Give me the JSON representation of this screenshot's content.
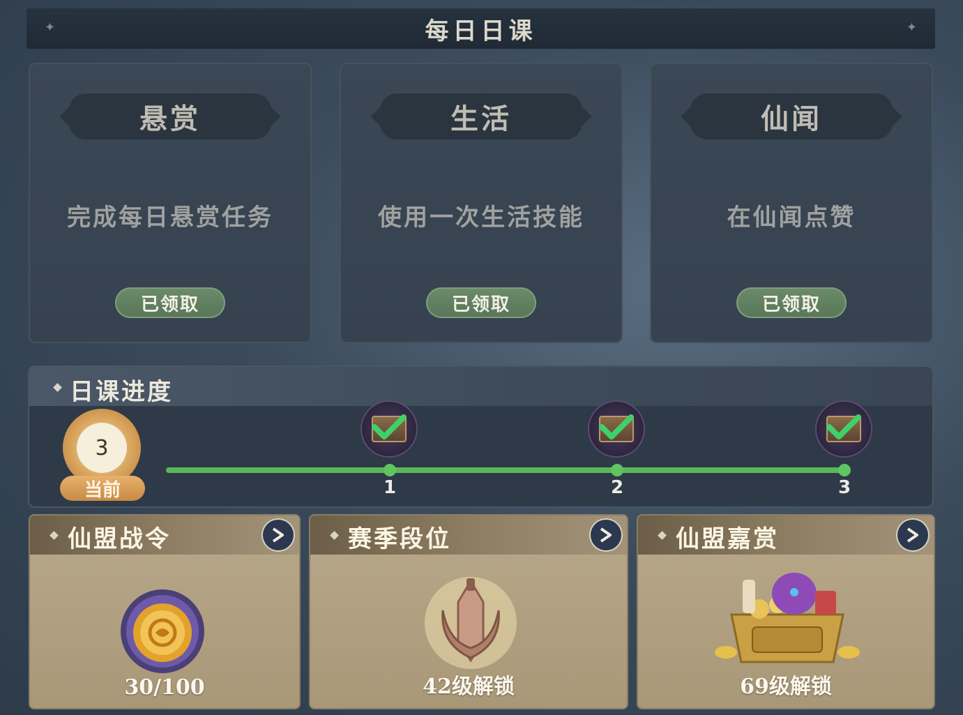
{
  "header": {
    "title": "每日日课"
  },
  "tasks": [
    {
      "category": "悬赏",
      "description": "完成每日悬赏任务",
      "status": "已领取"
    },
    {
      "category": "生活",
      "description": "使用一次生活技能",
      "status": "已领取"
    },
    {
      "category": "仙闻",
      "description": "在仙闻点赞",
      "status": "已领取"
    }
  ],
  "progress": {
    "title": "日课进度",
    "current_value": "3",
    "current_label": "当前",
    "nodes": [
      {
        "number": "1",
        "claimed": true
      },
      {
        "number": "2",
        "claimed": true
      },
      {
        "number": "3",
        "claimed": true
      }
    ],
    "fill_fraction": 1.0,
    "track_color": "#58b85a"
  },
  "rewards": [
    {
      "title": "仙盟战令",
      "caption": "30/100",
      "icon": "token-medallion-icon"
    },
    {
      "title": "赛季段位",
      "caption": "42级解锁",
      "icon": "rank-emblem-icon"
    },
    {
      "title": "仙盟嘉赏",
      "caption": "69级解锁",
      "icon": "treasure-chest-icon"
    }
  ]
}
